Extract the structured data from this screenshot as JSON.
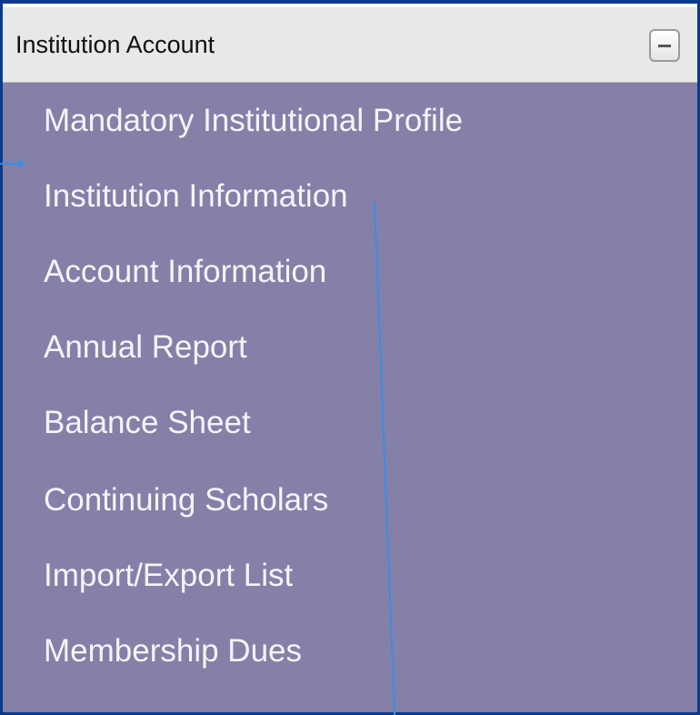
{
  "header": {
    "title": "Institution Account",
    "collapse_icon": "minus-icon"
  },
  "menu": {
    "items": [
      {
        "label": "Mandatory Institutional Profile"
      },
      {
        "label": "Institution Information"
      },
      {
        "label": "Account Information"
      },
      {
        "label": "Annual Report"
      },
      {
        "label": "Balance Sheet"
      },
      {
        "label": "Continuing Scholars"
      },
      {
        "label": "Import/Export List"
      },
      {
        "label": "Membership Dues"
      }
    ]
  },
  "colors": {
    "panel_bg": "#8480a8",
    "header_bg": "#e8e8e8",
    "border": "#0a3a8c",
    "menu_text": "#f4f4f8",
    "annotation": "#3a8ee6"
  }
}
